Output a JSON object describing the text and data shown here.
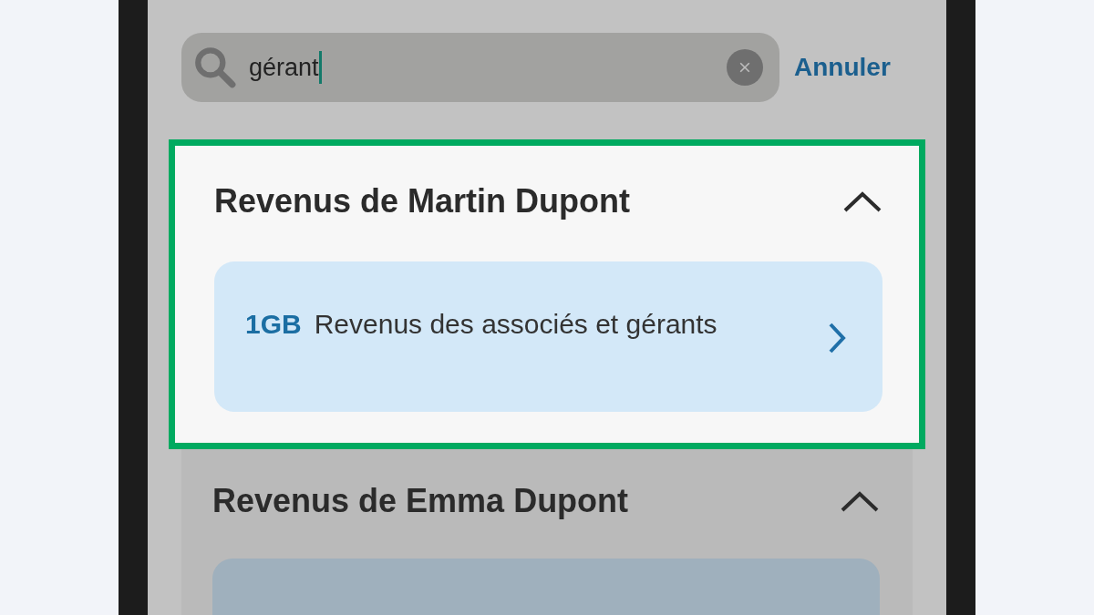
{
  "search": {
    "value": "gérant",
    "cancel": "Annuler"
  },
  "sections": [
    {
      "title": "Revenus de Martin Dupont",
      "expanded": true,
      "highlighted": true,
      "items": [
        {
          "kind": "entry",
          "code": "1GB",
          "label": "Revenus des associés et gérants"
        }
      ]
    },
    {
      "title": "Revenus de Emma Dupont",
      "expanded": true,
      "highlighted": false,
      "items": [
        {
          "kind": "cut"
        }
      ]
    }
  ]
}
